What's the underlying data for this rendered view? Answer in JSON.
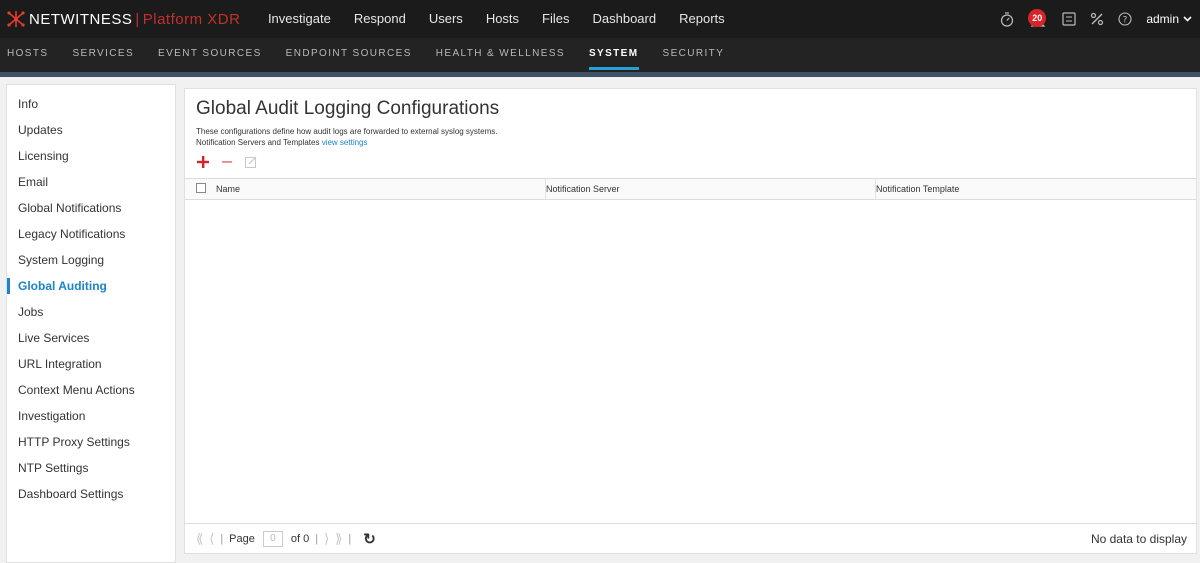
{
  "app": {
    "brand": "NETWITNESS",
    "separator": "|",
    "product": "Platform XDR"
  },
  "topnav": {
    "items": [
      "Investigate",
      "Respond",
      "Users",
      "Hosts",
      "Files",
      "Dashboard",
      "Reports"
    ]
  },
  "topbar": {
    "notification_count": "20",
    "user": "admin",
    "icons": [
      "timer-icon",
      "bell-icon",
      "dashboard-icon",
      "tools-icon",
      "help-icon"
    ]
  },
  "subnav": {
    "items": [
      "HOSTS",
      "SERVICES",
      "EVENT SOURCES",
      "ENDPOINT SOURCES",
      "HEALTH & WELLNESS",
      "SYSTEM",
      "SECURITY"
    ],
    "active": "SYSTEM"
  },
  "sidebar": {
    "items": [
      "Info",
      "Updates",
      "Licensing",
      "Email",
      "Global Notifications",
      "Legacy Notifications",
      "System Logging",
      "Global Auditing",
      "Jobs",
      "Live Services",
      "URL Integration",
      "Context Menu Actions",
      "Investigation",
      "HTTP Proxy Settings",
      "NTP Settings",
      "Dashboard Settings"
    ],
    "active": "Global Auditing"
  },
  "main": {
    "title": "Global Audit Logging Configurations",
    "description": "These configurations define how audit logs are forwarded to external syslog systems.",
    "settings_prefix": "Notification Servers and Templates",
    "settings_link": "view settings",
    "toolbar": [
      "add-icon",
      "remove-icon",
      "edit-icon"
    ]
  },
  "table": {
    "columns": [
      "Name",
      "Notification Server",
      "Notification Template"
    ],
    "rows": []
  },
  "pager": {
    "page_label": "Page",
    "page_value": "0",
    "of_label": "of 0",
    "status": "No data to display"
  },
  "colors": {
    "accent": "#1d84c6",
    "brand_red": "#c0322b",
    "topbar_bg": "#1b1b1b"
  }
}
